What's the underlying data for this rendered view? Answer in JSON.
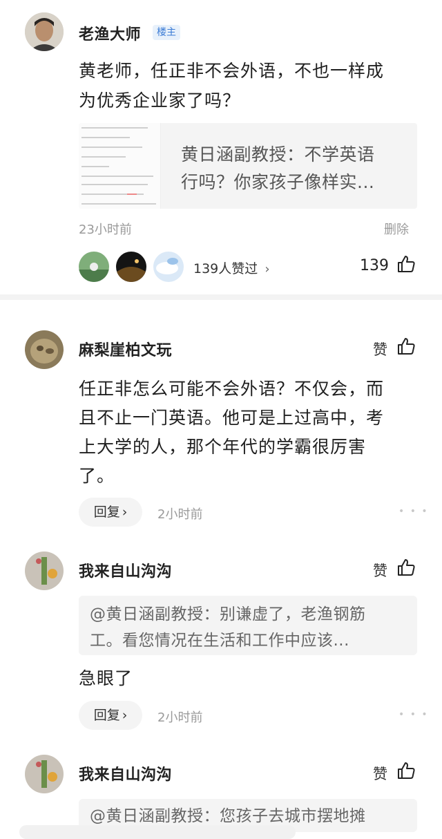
{
  "post": {
    "author": "老渔大师",
    "badge": "楼主",
    "text_lines": [
      "黄老师，任正非不会外语，不也一样成",
      "为优秀企业家了吗？"
    ],
    "link_card": {
      "title_lines": [
        "黄日涵副教授：不学英语",
        "行吗？你家孩子像样实..."
      ]
    },
    "time": "23小时前",
    "delete_label": "删除",
    "likers_text": "139人赞过",
    "like_count": "139"
  },
  "comments": [
    {
      "author": "麻梨崖柏文玩",
      "like_label": "赞",
      "text_lines": [
        "任正非怎么可能不会外语？不仅会，而",
        "且不止一门英语。他可是上过高中，考",
        "上大学的人，那个年代的学霸很厉害",
        "了。"
      ],
      "reply_label": "回复",
      "time": "2小时前"
    },
    {
      "author": "我来自山沟沟",
      "like_label": "赞",
      "quote_lines": [
        "@黄日涵副教授：别谦虚了，老渔钢筋",
        "工。看您情况在生活和工作中应该..."
      ],
      "text": "急眼了",
      "reply_label": "回复",
      "time": "2小时前"
    },
    {
      "author": "我来自山沟沟",
      "like_label": "赞",
      "quote_partial": "@黄日涵副教授：您孩子去城市摆地摊"
    }
  ],
  "icons": {
    "thumb": "thumbs-up-icon",
    "chevron": "chevron-right-icon",
    "more": "more-dots-icon"
  },
  "colors": {
    "badge_bg": "#e8f1fb",
    "badge_text": "#3a7bd5",
    "muted": "#9a9a9a"
  }
}
